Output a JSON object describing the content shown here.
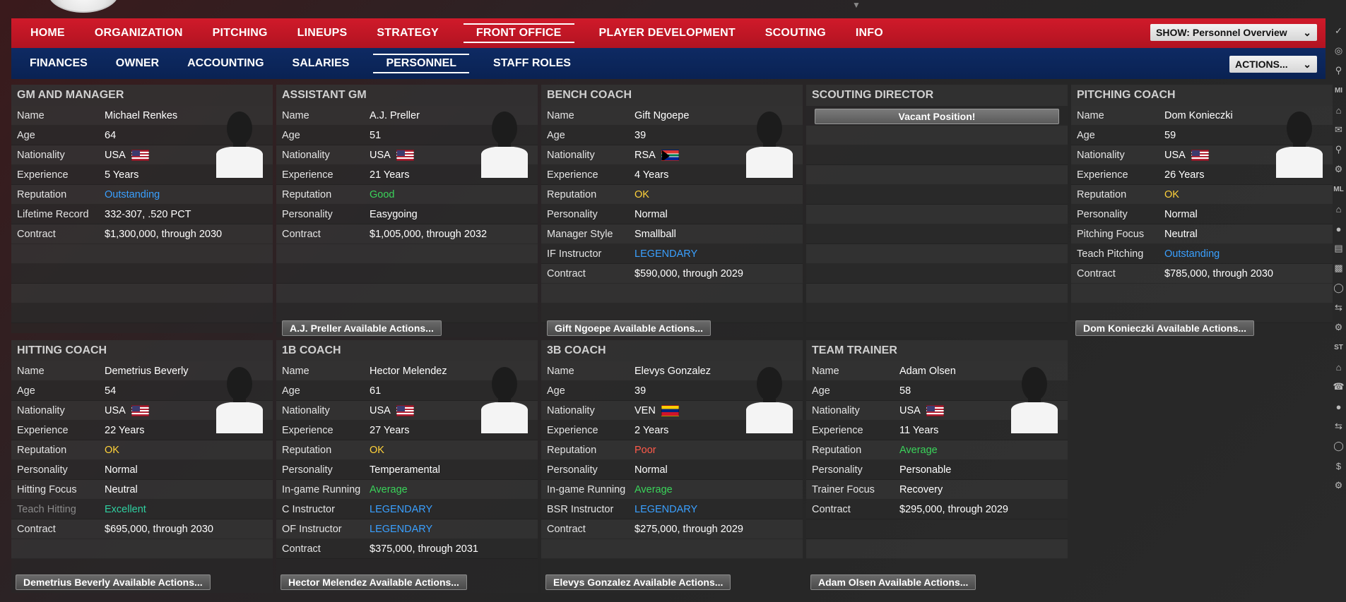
{
  "nav": {
    "main": [
      {
        "label": "HOME"
      },
      {
        "label": "ORGANIZATION"
      },
      {
        "label": "PITCHING"
      },
      {
        "label": "LINEUPS"
      },
      {
        "label": "STRATEGY"
      },
      {
        "label": "FRONT OFFICE",
        "active": true
      },
      {
        "label": "PLAYER DEVELOPMENT"
      },
      {
        "label": "SCOUTING"
      },
      {
        "label": "INFO"
      }
    ],
    "show_select": "SHOW: Personnel Overview",
    "sub": [
      {
        "label": "FINANCES"
      },
      {
        "label": "OWNER"
      },
      {
        "label": "ACCOUNTING"
      },
      {
        "label": "SALARIES"
      },
      {
        "label": "PERSONNEL",
        "active": true
      },
      {
        "label": "STAFF ROLES"
      }
    ],
    "actions_select": "ACTIONS..."
  },
  "colors": {
    "legendary": "#3aa0ff",
    "outstanding": "#3aa0ff",
    "excellent": "#2fd0a0",
    "good": "#3ad35a",
    "average": "#3ad35a",
    "ok": "#ffd23a",
    "poor": "#ff5a4a"
  },
  "panels": {
    "gm": {
      "title": "GM AND MANAGER",
      "rows": [
        {
          "k": "Name",
          "v": "Michael Renkes"
        },
        {
          "k": "Age",
          "v": "64"
        },
        {
          "k": "Nationality",
          "v": "USA"
        },
        {
          "k": "Experience",
          "v": "5 Years"
        },
        {
          "k": "Reputation",
          "v": "Outstanding"
        },
        {
          "k": "Lifetime Record",
          "v": "332-307, .520 PCT"
        },
        {
          "k": "Contract",
          "v": "$1,300,000, through 2030"
        }
      ]
    },
    "agm": {
      "title": "ASSISTANT GM",
      "rows": [
        {
          "k": "Name",
          "v": "A.J. Preller"
        },
        {
          "k": "Age",
          "v": "51"
        },
        {
          "k": "Nationality",
          "v": "USA"
        },
        {
          "k": "Experience",
          "v": "21 Years"
        },
        {
          "k": "Reputation",
          "v": "Good"
        },
        {
          "k": "Personality",
          "v": "Easygoing"
        },
        {
          "k": "Contract",
          "v": "$1,005,000, through 2032"
        }
      ],
      "action": "A.J. Preller Available Actions..."
    },
    "bench": {
      "title": "BENCH COACH",
      "rows": [
        {
          "k": "Name",
          "v": "Gift Ngoepe"
        },
        {
          "k": "Age",
          "v": "39"
        },
        {
          "k": "Nationality",
          "v": "RSA"
        },
        {
          "k": "Experience",
          "v": "4 Years"
        },
        {
          "k": "Reputation",
          "v": "OK"
        },
        {
          "k": "Personality",
          "v": "Normal"
        },
        {
          "k": "Manager Style",
          "v": "Smallball"
        },
        {
          "k": "IF Instructor",
          "v": "LEGENDARY"
        },
        {
          "k": "Contract",
          "v": "$590,000, through 2029"
        }
      ],
      "action": "Gift Ngoepe Available Actions..."
    },
    "scout": {
      "title": "SCOUTING DIRECTOR",
      "vacant": "Vacant Position!"
    },
    "pitch": {
      "title": "PITCHING COACH",
      "rows": [
        {
          "k": "Name",
          "v": "Dom Konieczki"
        },
        {
          "k": "Age",
          "v": "59"
        },
        {
          "k": "Nationality",
          "v": "USA"
        },
        {
          "k": "Experience",
          "v": "26 Years"
        },
        {
          "k": "Reputation",
          "v": "OK"
        },
        {
          "k": "Personality",
          "v": "Normal"
        },
        {
          "k": "Pitching Focus",
          "v": "Neutral"
        },
        {
          "k": "Teach Pitching",
          "v": "Outstanding"
        },
        {
          "k": "Contract",
          "v": "$785,000, through 2030"
        }
      ],
      "action": "Dom Konieczki Available Actions..."
    },
    "hit": {
      "title": "HITTING COACH",
      "rows": [
        {
          "k": "Name",
          "v": "Demetrius Beverly"
        },
        {
          "k": "Age",
          "v": "54"
        },
        {
          "k": "Nationality",
          "v": "USA"
        },
        {
          "k": "Experience",
          "v": "22 Years"
        },
        {
          "k": "Reputation",
          "v": "OK"
        },
        {
          "k": "Personality",
          "v": "Normal"
        },
        {
          "k": "Hitting Focus",
          "v": "Neutral"
        },
        {
          "k": "Teach Hitting",
          "v": "Excellent"
        },
        {
          "k": "Contract",
          "v": "$695,000, through 2030"
        }
      ],
      "action": "Demetrius Beverly Available Actions..."
    },
    "first": {
      "title": "1B COACH",
      "rows": [
        {
          "k": "Name",
          "v": "Hector Melendez"
        },
        {
          "k": "Age",
          "v": "61"
        },
        {
          "k": "Nationality",
          "v": "USA"
        },
        {
          "k": "Experience",
          "v": "27 Years"
        },
        {
          "k": "Reputation",
          "v": "OK"
        },
        {
          "k": "Personality",
          "v": "Temperamental"
        },
        {
          "k": "In-game Running",
          "v": "Average"
        },
        {
          "k": "C Instructor",
          "v": "LEGENDARY"
        },
        {
          "k": "OF Instructor",
          "v": "LEGENDARY"
        },
        {
          "k": "Contract",
          "v": "$375,000, through 2031"
        }
      ],
      "action": "Hector Melendez Available Actions..."
    },
    "third": {
      "title": "3B COACH",
      "rows": [
        {
          "k": "Name",
          "v": "Elevys Gonzalez"
        },
        {
          "k": "Age",
          "v": "39"
        },
        {
          "k": "Nationality",
          "v": "VEN"
        },
        {
          "k": "Experience",
          "v": "2 Years"
        },
        {
          "k": "Reputation",
          "v": "Poor"
        },
        {
          "k": "Personality",
          "v": "Normal"
        },
        {
          "k": "In-game Running",
          "v": "Average"
        },
        {
          "k": "BSR Instructor",
          "v": "LEGENDARY"
        },
        {
          "k": "Contract",
          "v": "$275,000, through 2029"
        }
      ],
      "action": "Elevys Gonzalez Available Actions..."
    },
    "trainer": {
      "title": "TEAM TRAINER",
      "rows": [
        {
          "k": "Name",
          "v": "Adam Olsen"
        },
        {
          "k": "Age",
          "v": "58"
        },
        {
          "k": "Nationality",
          "v": "USA"
        },
        {
          "k": "Experience",
          "v": "11 Years"
        },
        {
          "k": "Reputation",
          "v": "Average"
        },
        {
          "k": "Personality",
          "v": "Personable"
        },
        {
          "k": "Trainer Focus",
          "v": "Recovery"
        },
        {
          "k": "Contract",
          "v": "$295,000, through 2029"
        }
      ],
      "action": "Adam Olsen Available Actions..."
    }
  },
  "rail": {
    "labels": [
      "MI",
      "ML",
      "ST"
    ]
  }
}
